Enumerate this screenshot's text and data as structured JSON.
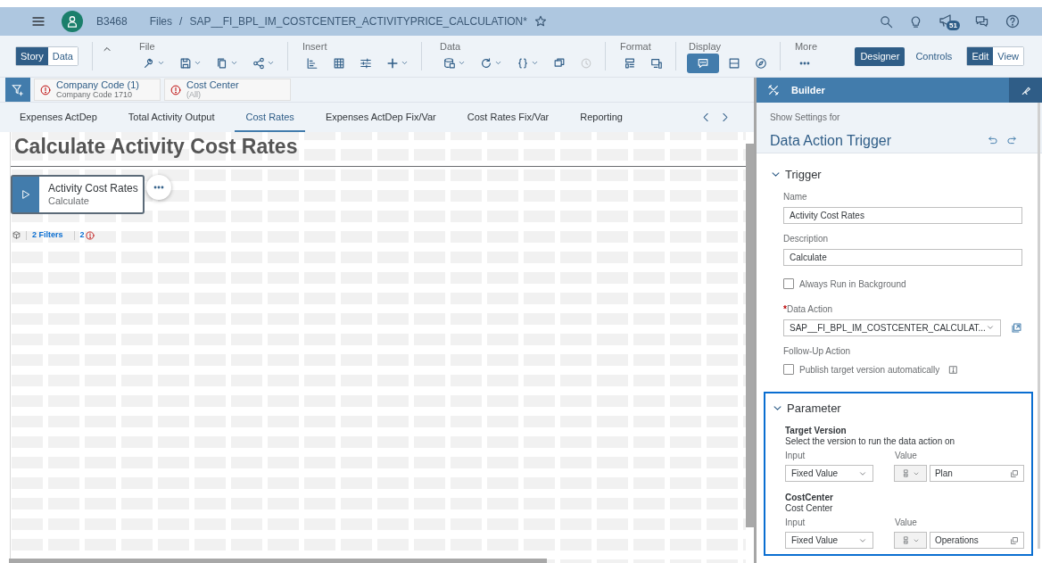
{
  "header": {
    "user_id": "B3468",
    "breadcrumb_root": "Files",
    "breadcrumb_separator": "/",
    "file_title": "SAP__FI_BPL_IM_COSTCENTER_ACTIVITYPRICE_CALCULATION*",
    "notification_count": "51"
  },
  "toolbar": {
    "mode_toggle": [
      {
        "label": "Story",
        "selected": true
      },
      {
        "label": "Data",
        "selected": false
      }
    ],
    "groups": [
      {
        "label": "File",
        "tools": [
          {
            "dropdown": true,
            "selected": false,
            "disabled": false
          },
          {
            "dropdown": true,
            "selected": false,
            "disabled": false
          },
          {
            "dropdown": true,
            "selected": false,
            "disabled": false
          },
          {
            "dropdown": true,
            "selected": false,
            "disabled": false
          }
        ]
      },
      {
        "label": "Insert",
        "tools": [
          {
            "dropdown": false,
            "selected": false,
            "disabled": false
          },
          {
            "dropdown": false,
            "selected": false,
            "disabled": false
          },
          {
            "dropdown": false,
            "selected": false,
            "disabled": false
          },
          {
            "dropdown": true,
            "selected": false,
            "disabled": false
          }
        ]
      },
      {
        "label": "Data",
        "tools": [
          {
            "dropdown": true,
            "selected": false,
            "disabled": false
          },
          {
            "dropdown": true,
            "selected": false,
            "disabled": false
          },
          {
            "dropdown": true,
            "selected": false,
            "disabled": false
          },
          {
            "dropdown": false,
            "selected": false,
            "disabled": false
          },
          {
            "dropdown": false,
            "selected": false,
            "disabled": true
          }
        ]
      },
      {
        "label": "Format",
        "tools": [
          {
            "dropdown": false,
            "selected": false,
            "disabled": false
          },
          {
            "dropdown": false,
            "selected": false,
            "disabled": false
          }
        ]
      },
      {
        "label": "Display",
        "tools": [
          {
            "dropdown": false,
            "selected": true,
            "disabled": false
          },
          {
            "dropdown": false,
            "selected": false,
            "disabled": false
          },
          {
            "dropdown": false,
            "selected": false,
            "disabled": false
          }
        ]
      },
      {
        "label": "More",
        "tools": [
          {
            "dropdown": false,
            "selected": false,
            "disabled": false
          }
        ]
      }
    ],
    "panel_toggle": [
      {
        "label": "Designer",
        "selected": true
      },
      {
        "label": "Controls",
        "selected": false
      }
    ],
    "view_toggle": [
      {
        "label": "Edit",
        "selected": true
      },
      {
        "label": "View",
        "selected": false
      }
    ]
  },
  "filters": [
    {
      "title": "Company Code (1)",
      "value": "Company Code 1710"
    },
    {
      "title": "Cost Center",
      "value": "(All)"
    }
  ],
  "page_tabs": [
    {
      "label": "Expenses ActDep",
      "selected": false
    },
    {
      "label": "Total Activity Output",
      "selected": false
    },
    {
      "label": "Cost Rates",
      "selected": true
    },
    {
      "label": "Expenses ActDep Fix/Var",
      "selected": false
    },
    {
      "label": "Cost Rates Fix/Var",
      "selected": false
    },
    {
      "label": "Reporting",
      "selected": false
    }
  ],
  "canvas": {
    "heading": "Calculate Activity Cost Rates",
    "trigger": {
      "title": "Activity Cost Rates",
      "subtitle": "Calculate",
      "selected": true
    },
    "filter_link": "2 Filters",
    "error_count": "2"
  },
  "builder": {
    "title": "Builder",
    "settings_for": "Show Settings for",
    "object_title": "Data Action Trigger",
    "trigger": {
      "title": "Trigger",
      "expanded": true,
      "name_label": "Name",
      "name_value": "Activity Cost Rates",
      "description_label": "Description",
      "description_value": "Calculate",
      "background_label": "Always Run in Background",
      "background_checked": false,
      "data_action_label": "Data Action",
      "data_action_required": true,
      "required_mark": "*",
      "data_action_value": "SAP__FI_BPL_IM_COSTCENTER_CALCULAT...",
      "followup_label": "Follow-Up Action",
      "publish_label": "Publish target version automatically",
      "publish_checked": false
    },
    "parameter": {
      "title": "Parameter",
      "expanded": true,
      "highlighted": true,
      "params": [
        {
          "name": "Target Version",
          "description": "Select the version to run the data action on",
          "input_label": "Input",
          "input_value": "Fixed Value",
          "value_label": "Value",
          "value": "Plan"
        },
        {
          "name": "CostCenter",
          "description": "Cost Center",
          "input_label": "Input",
          "input_value": "Fixed Value",
          "value_label": "Value",
          "value": "Operations"
        }
      ]
    }
  }
}
